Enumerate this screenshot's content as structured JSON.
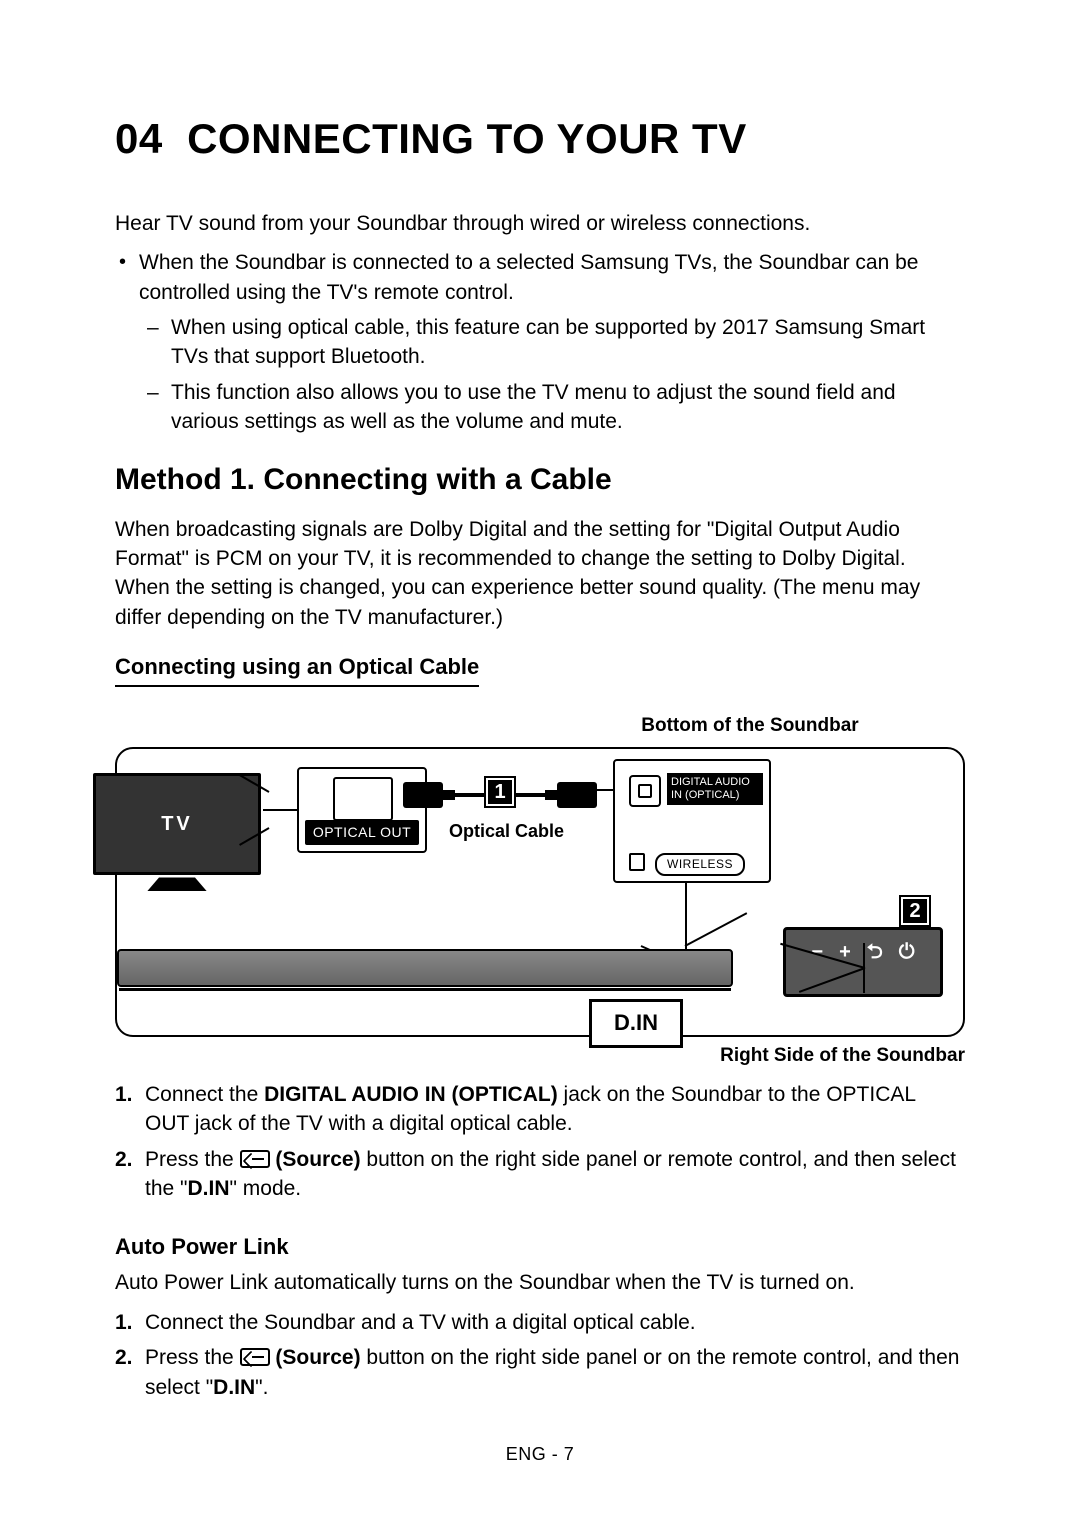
{
  "section_number": "04",
  "section_title": "CONNECTING TO YOUR TV",
  "intro": "Hear TV sound from your Soundbar through wired or wireless connections.",
  "bullets": {
    "b1": "When the Soundbar is connected to a selected Samsung TVs, the Soundbar can be controlled using the TV's remote control.",
    "b1a": "When using optical cable, this feature can be supported by 2017 Samsung Smart TVs that support Bluetooth.",
    "b1b": "This function also allows you to use the TV menu to adjust the sound field and various settings as well as the volume and mute."
  },
  "method1_title": "Method 1. Connecting with a Cable",
  "method1_para": "When broadcasting signals are Dolby Digital and the setting for \"Digital Output Audio Format\" is PCM on your TV, it is recommended to change the setting to Dolby Digital. When the setting is changed, you can experience better sound quality. (The menu may differ depending on the TV manufacturer.)",
  "optical_heading": "Connecting using an Optical Cable",
  "diagram": {
    "top_label": "Bottom of the Soundbar",
    "bottom_label": "Right Side of the Soundbar",
    "tv_label": "TV",
    "optical_out": "OPTICAL OUT",
    "cable_label": "Optical Cable",
    "digital_in": "DIGITAL AUDIO IN (OPTICAL)",
    "wireless": "WIRELESS",
    "din": "D.IN",
    "badge1": "1",
    "badge2": "2"
  },
  "steps": {
    "s1": {
      "marker": "1.",
      "pre": "Connect the ",
      "bold": "DIGITAL AUDIO IN (OPTICAL)",
      "post": " jack on the Soundbar to the OPTICAL OUT jack of the TV with a digital optical cable."
    },
    "s2": {
      "marker": "2.",
      "pre": "Press the ",
      "bold": " (Source)",
      "mid": " button on the right side panel or remote control, and then select the \"",
      "din": "D.IN",
      "post": "\" mode."
    }
  },
  "apl_heading": "Auto Power Link",
  "apl_para": "Auto Power Link automatically turns on the Soundbar when the TV is turned on.",
  "apl_steps": {
    "s1": {
      "marker": "1.",
      "text": "Connect the Soundbar and a TV with a digital optical cable."
    },
    "s2": {
      "marker": "2.",
      "pre": "Press the ",
      "bold": " (Source)",
      "mid": " button on the right side panel or on the remote control, and then select \"",
      "din": "D.IN",
      "post": "\"."
    }
  },
  "footer": "ENG - 7"
}
